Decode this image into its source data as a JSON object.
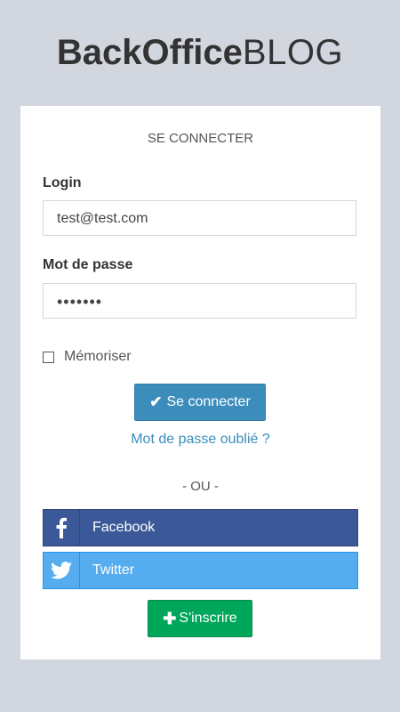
{
  "logo": {
    "bold": "BackOffice",
    "light": "BLOG"
  },
  "login_box": {
    "title": "SE CONNECTER",
    "login_label": "Login",
    "login_value": "test@test.com",
    "password_label": "Mot de passe",
    "password_value": "•••••••",
    "remember_label": "Mémoriser",
    "remember_checked": false,
    "submit_label": "Se connecter",
    "submit_icon": "check-icon",
    "forgot_link": "Mot de passe oublié ?",
    "separator": "- OU -",
    "facebook_label": "Facebook",
    "facebook_icon": "facebook-icon",
    "twitter_label": "Twitter",
    "twitter_icon": "twitter-icon",
    "register_label": "S'inscrire",
    "register_icon": "plus-icon"
  },
  "colors": {
    "background": "#d2d6de",
    "primary": "#3c8dbc",
    "facebook": "#3b5998",
    "twitter": "#55acee",
    "success": "#00a65a"
  }
}
